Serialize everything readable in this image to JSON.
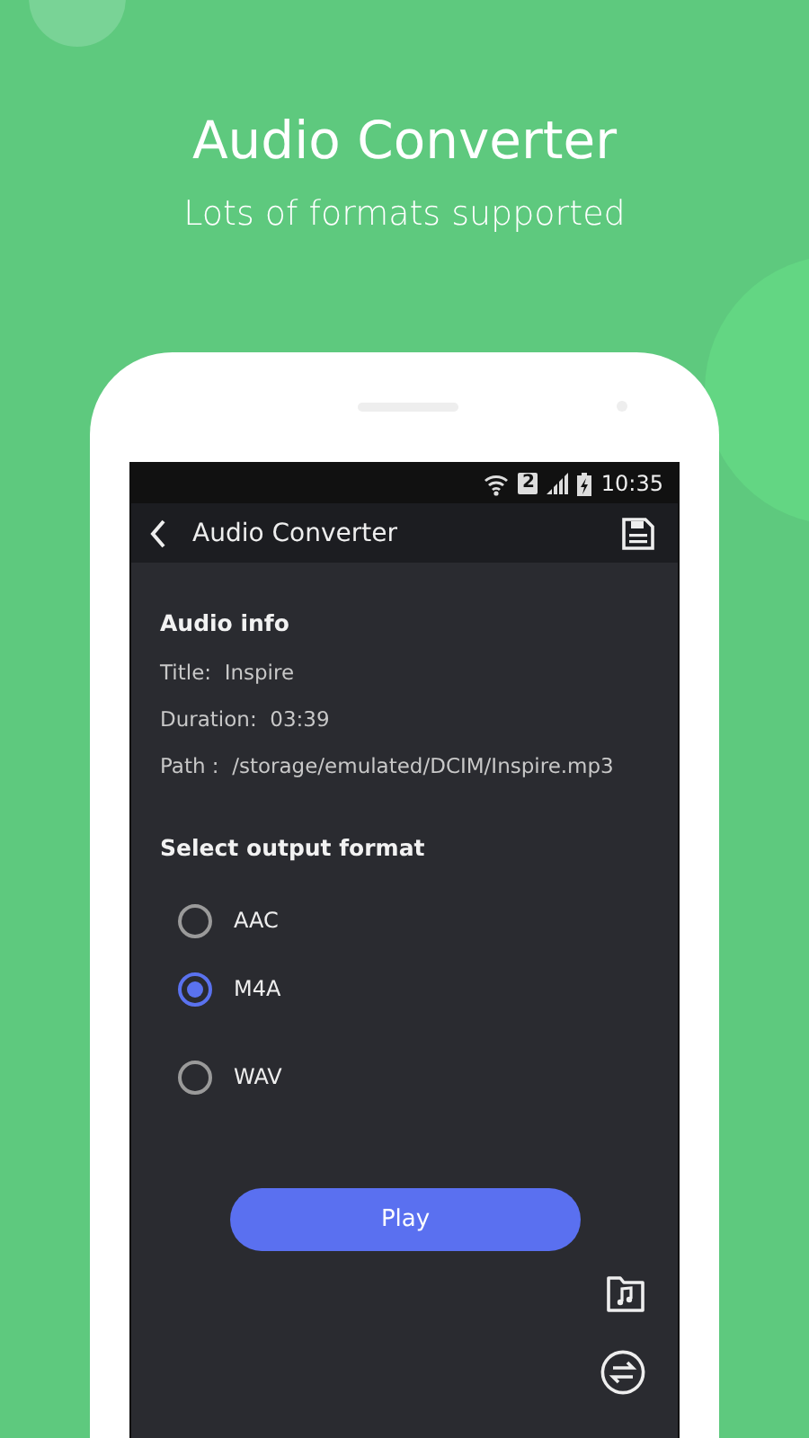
{
  "headline": "Audio Converter",
  "subheadline": "Lots of formats supported",
  "status_bar": {
    "sim": "2",
    "time": "10:35"
  },
  "toolbar": {
    "title": "Audio Converter"
  },
  "audio_info": {
    "heading": "Audio info",
    "rows": [
      {
        "label": "Title:",
        "value": "Inspire"
      },
      {
        "label": "Duration:",
        "value": "03:39"
      },
      {
        "label": "Path :",
        "value": "/storage/emulated/DCIM/Inspire.mp3"
      }
    ]
  },
  "output_format": {
    "heading": "Select output format",
    "options": [
      {
        "label": "AAC",
        "selected": false
      },
      {
        "label": "M4A",
        "selected": true
      },
      {
        "label": "WAV",
        "selected": false
      }
    ]
  },
  "play_button": "Play"
}
